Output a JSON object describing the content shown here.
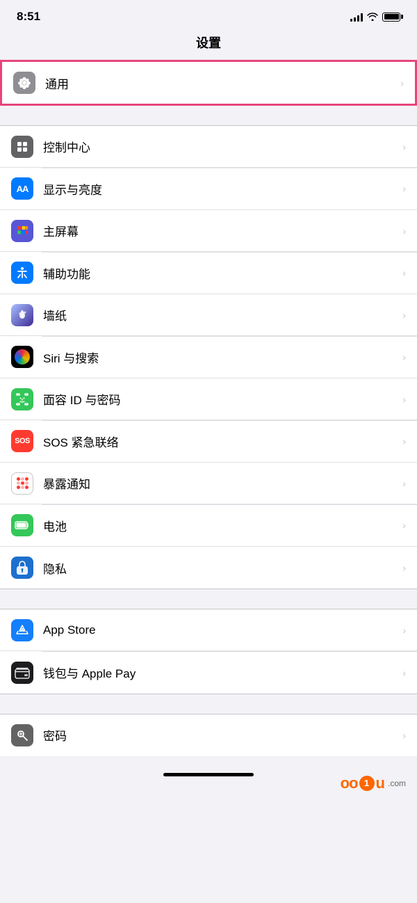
{
  "statusBar": {
    "time": "8:51"
  },
  "page": {
    "title": "设置"
  },
  "groups": [
    {
      "id": "general-group",
      "highlighted": true,
      "items": [
        {
          "id": "general",
          "label": "通用",
          "iconType": "gear",
          "iconBg": "gray"
        }
      ]
    },
    {
      "id": "main-group",
      "highlighted": false,
      "items": [
        {
          "id": "control-center",
          "label": "控制中心",
          "iconType": "control",
          "iconBg": "gray"
        },
        {
          "id": "display",
          "label": "显示与亮度",
          "iconType": "AA",
          "iconBg": "blue"
        },
        {
          "id": "homescreen",
          "label": "主屏幕",
          "iconType": "grid",
          "iconBg": "blue2"
        },
        {
          "id": "accessibility",
          "label": "辅助功能",
          "iconType": "person-circle",
          "iconBg": "blue"
        },
        {
          "id": "wallpaper",
          "label": "墙纸",
          "iconType": "flower",
          "iconBg": "colorful"
        },
        {
          "id": "siri",
          "label": "Siri 与搜索",
          "iconType": "siri",
          "iconBg": "siri"
        },
        {
          "id": "faceid",
          "label": "面容 ID 与密码",
          "iconType": "faceid",
          "iconBg": "green"
        },
        {
          "id": "sos",
          "label": "SOS 紧急联络",
          "iconType": "sos",
          "iconBg": "red"
        },
        {
          "id": "exposure",
          "label": "暴露通知",
          "iconType": "exposure",
          "iconBg": "white"
        },
        {
          "id": "battery",
          "label": "电池",
          "iconType": "battery",
          "iconBg": "green"
        },
        {
          "id": "privacy",
          "label": "隐私",
          "iconType": "hand",
          "iconBg": "blue"
        }
      ]
    },
    {
      "id": "store-group",
      "highlighted": false,
      "items": [
        {
          "id": "appstore",
          "label": "App Store",
          "iconType": "appstore",
          "iconBg": "blue"
        },
        {
          "id": "wallet",
          "label": "钱包与 Apple Pay",
          "iconType": "wallet",
          "iconBg": "black"
        }
      ]
    },
    {
      "id": "password-group",
      "highlighted": false,
      "items": [
        {
          "id": "passwords",
          "label": "密码",
          "iconType": "key",
          "iconBg": "gray"
        }
      ]
    }
  ]
}
